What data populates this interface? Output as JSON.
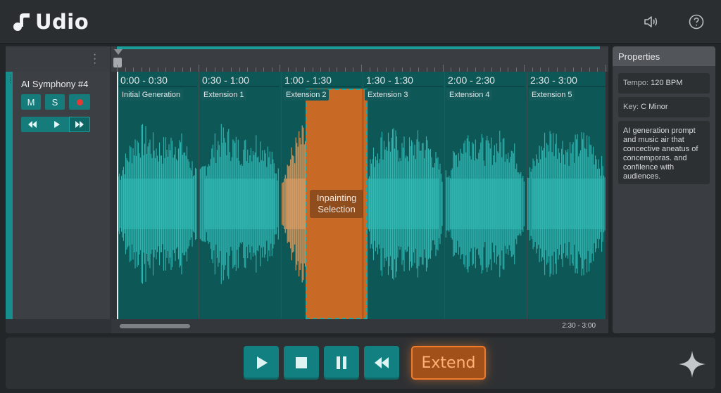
{
  "app": {
    "name": "Udio"
  },
  "track": {
    "name": "AI Symphony #4",
    "mute_label": "M",
    "solo_label": "S"
  },
  "segments": [
    {
      "time": "0:00 - 0:30",
      "label": "Initial Generation"
    },
    {
      "time": "0:30 - 1:00",
      "label": "Extension 1"
    },
    {
      "time": "1:00 - 1:30",
      "label": "Extension 2"
    },
    {
      "time": "1:30 - 1:30",
      "label": "Extension 3"
    },
    {
      "time": "2:00 - 2:30",
      "label": "Extension 4"
    },
    {
      "time": "2:30 - 3:00",
      "label": "Extension 5"
    }
  ],
  "inpaint": {
    "label": "Inpainting Selection"
  },
  "scroll": {
    "range": "2:30 - 3:00"
  },
  "properties": {
    "title": "Properties",
    "tempo_label": "Tempo:",
    "tempo_value": "120 BPM",
    "key_label": "Key:",
    "key_value": "C Minor",
    "description": "AI generation prompt and music air that concective aneatus of concemporas. and confilence with audiences."
  },
  "transport": {
    "extend_label": "Extend"
  },
  "colors": {
    "accent": "#128080",
    "waveform": "#2fb5b0",
    "selection": "#c86a25",
    "extend_border": "#f07b2a"
  }
}
